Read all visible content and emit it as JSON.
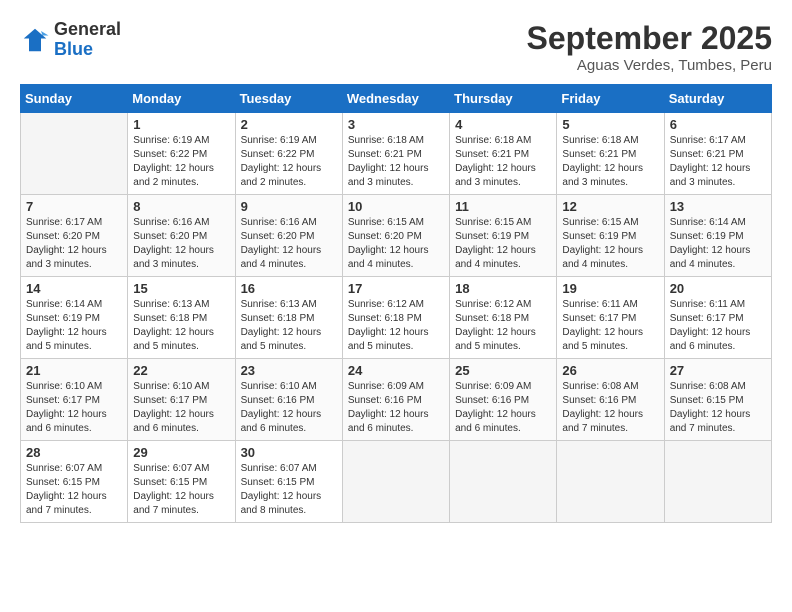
{
  "header": {
    "logo_line1": "General",
    "logo_line2": "Blue",
    "month_title": "September 2025",
    "location": "Aguas Verdes, Tumbes, Peru"
  },
  "days_of_week": [
    "Sunday",
    "Monday",
    "Tuesday",
    "Wednesday",
    "Thursday",
    "Friday",
    "Saturday"
  ],
  "weeks": [
    [
      {
        "num": "",
        "info": "",
        "empty": true
      },
      {
        "num": "1",
        "info": "Sunrise: 6:19 AM\nSunset: 6:22 PM\nDaylight: 12 hours\nand 2 minutes."
      },
      {
        "num": "2",
        "info": "Sunrise: 6:19 AM\nSunset: 6:22 PM\nDaylight: 12 hours\nand 2 minutes."
      },
      {
        "num": "3",
        "info": "Sunrise: 6:18 AM\nSunset: 6:21 PM\nDaylight: 12 hours\nand 3 minutes."
      },
      {
        "num": "4",
        "info": "Sunrise: 6:18 AM\nSunset: 6:21 PM\nDaylight: 12 hours\nand 3 minutes."
      },
      {
        "num": "5",
        "info": "Sunrise: 6:18 AM\nSunset: 6:21 PM\nDaylight: 12 hours\nand 3 minutes."
      },
      {
        "num": "6",
        "info": "Sunrise: 6:17 AM\nSunset: 6:21 PM\nDaylight: 12 hours\nand 3 minutes."
      }
    ],
    [
      {
        "num": "7",
        "info": "Sunrise: 6:17 AM\nSunset: 6:20 PM\nDaylight: 12 hours\nand 3 minutes."
      },
      {
        "num": "8",
        "info": "Sunrise: 6:16 AM\nSunset: 6:20 PM\nDaylight: 12 hours\nand 3 minutes."
      },
      {
        "num": "9",
        "info": "Sunrise: 6:16 AM\nSunset: 6:20 PM\nDaylight: 12 hours\nand 4 minutes."
      },
      {
        "num": "10",
        "info": "Sunrise: 6:15 AM\nSunset: 6:20 PM\nDaylight: 12 hours\nand 4 minutes."
      },
      {
        "num": "11",
        "info": "Sunrise: 6:15 AM\nSunset: 6:19 PM\nDaylight: 12 hours\nand 4 minutes."
      },
      {
        "num": "12",
        "info": "Sunrise: 6:15 AM\nSunset: 6:19 PM\nDaylight: 12 hours\nand 4 minutes."
      },
      {
        "num": "13",
        "info": "Sunrise: 6:14 AM\nSunset: 6:19 PM\nDaylight: 12 hours\nand 4 minutes."
      }
    ],
    [
      {
        "num": "14",
        "info": "Sunrise: 6:14 AM\nSunset: 6:19 PM\nDaylight: 12 hours\nand 5 minutes."
      },
      {
        "num": "15",
        "info": "Sunrise: 6:13 AM\nSunset: 6:18 PM\nDaylight: 12 hours\nand 5 minutes."
      },
      {
        "num": "16",
        "info": "Sunrise: 6:13 AM\nSunset: 6:18 PM\nDaylight: 12 hours\nand 5 minutes."
      },
      {
        "num": "17",
        "info": "Sunrise: 6:12 AM\nSunset: 6:18 PM\nDaylight: 12 hours\nand 5 minutes."
      },
      {
        "num": "18",
        "info": "Sunrise: 6:12 AM\nSunset: 6:18 PM\nDaylight: 12 hours\nand 5 minutes."
      },
      {
        "num": "19",
        "info": "Sunrise: 6:11 AM\nSunset: 6:17 PM\nDaylight: 12 hours\nand 5 minutes."
      },
      {
        "num": "20",
        "info": "Sunrise: 6:11 AM\nSunset: 6:17 PM\nDaylight: 12 hours\nand 6 minutes."
      }
    ],
    [
      {
        "num": "21",
        "info": "Sunrise: 6:10 AM\nSunset: 6:17 PM\nDaylight: 12 hours\nand 6 minutes."
      },
      {
        "num": "22",
        "info": "Sunrise: 6:10 AM\nSunset: 6:17 PM\nDaylight: 12 hours\nand 6 minutes."
      },
      {
        "num": "23",
        "info": "Sunrise: 6:10 AM\nSunset: 6:16 PM\nDaylight: 12 hours\nand 6 minutes."
      },
      {
        "num": "24",
        "info": "Sunrise: 6:09 AM\nSunset: 6:16 PM\nDaylight: 12 hours\nand 6 minutes."
      },
      {
        "num": "25",
        "info": "Sunrise: 6:09 AM\nSunset: 6:16 PM\nDaylight: 12 hours\nand 6 minutes."
      },
      {
        "num": "26",
        "info": "Sunrise: 6:08 AM\nSunset: 6:16 PM\nDaylight: 12 hours\nand 7 minutes."
      },
      {
        "num": "27",
        "info": "Sunrise: 6:08 AM\nSunset: 6:15 PM\nDaylight: 12 hours\nand 7 minutes."
      }
    ],
    [
      {
        "num": "28",
        "info": "Sunrise: 6:07 AM\nSunset: 6:15 PM\nDaylight: 12 hours\nand 7 minutes."
      },
      {
        "num": "29",
        "info": "Sunrise: 6:07 AM\nSunset: 6:15 PM\nDaylight: 12 hours\nand 7 minutes."
      },
      {
        "num": "30",
        "info": "Sunrise: 6:07 AM\nSunset: 6:15 PM\nDaylight: 12 hours\nand 8 minutes."
      },
      {
        "num": "",
        "info": "",
        "empty": true
      },
      {
        "num": "",
        "info": "",
        "empty": true
      },
      {
        "num": "",
        "info": "",
        "empty": true
      },
      {
        "num": "",
        "info": "",
        "empty": true
      }
    ]
  ]
}
